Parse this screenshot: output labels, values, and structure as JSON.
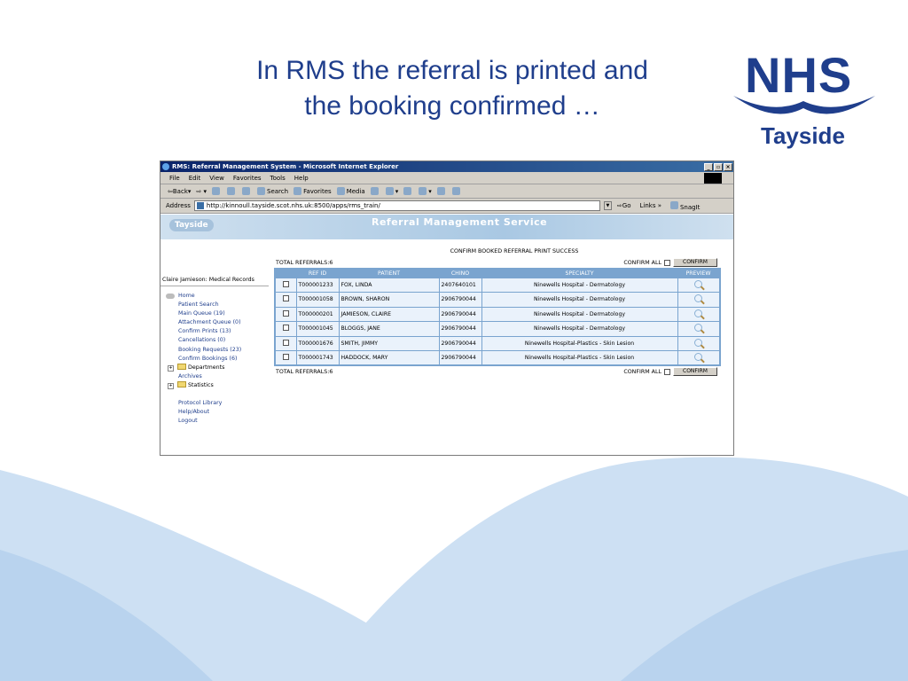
{
  "slide": {
    "title_line1": "In RMS the referral is printed and",
    "title_line2": "the booking confirmed …",
    "logo_text": "NHS",
    "logo_subtext": "Tayside",
    "brand_color": "#1f3e8c",
    "wave_color": "#cde0f3"
  },
  "browser": {
    "window_title": "RMS: Referral Management System - Microsoft Internet Explorer",
    "menu": [
      "File",
      "Edit",
      "View",
      "Favorites",
      "Tools",
      "Help"
    ],
    "toolbar": [
      "Back",
      "Search",
      "Favorites",
      "Media"
    ],
    "address_label": "Address",
    "address_url": "http://kinnoull.tayside.scot.nhs.uk:8500/apps/rms_train/",
    "go_label": "Go",
    "links_label": "Links",
    "snagit_label": "SnagIt"
  },
  "app": {
    "banner_logo": "Tayside",
    "banner_title": "Referral Management Service",
    "user": "Claire Jamieson: Medical Records",
    "nav": {
      "home": "Home",
      "patient_search": "Patient Search",
      "main_queue": "Main Queue (19)",
      "attachment_queue": "Attachment Queue (0)",
      "confirm_prints": "Confirm Prints (13)",
      "cancellations": "Cancellations (0)",
      "booking_requests": "Booking Requests (23)",
      "confirm_bookings": "Confirm Bookings (6)",
      "departments": "Departments",
      "archives": "Archives",
      "statistics": "Statistics",
      "protocol_library": "Protocol Library",
      "help_about": "Help/About",
      "logout": "Logout"
    },
    "confirm_message": "CONFIRM BOOKED REFERRAL PRINT SUCCESS",
    "total_referrals": "TOTAL REFERRALS:6",
    "confirm_all_label": "CONFIRM ALL",
    "confirm_button": "CONFIRM",
    "columns": {
      "ref_id": "REF ID",
      "patient": "PATIENT",
      "chino": "CHINO",
      "specialty": "SPECIALTY",
      "preview": "PREVIEW"
    },
    "rows": [
      {
        "ref_id": "T000001233",
        "patient": "FOX, LINDA",
        "chino": "2407640101",
        "specialty": "Ninewells Hospital - Dermatology"
      },
      {
        "ref_id": "T000001058",
        "patient": "BROWN, SHARON",
        "chino": "2906790044",
        "specialty": "Ninewells Hospital - Dermatology"
      },
      {
        "ref_id": "T000000201",
        "patient": "JAMIESON, CLAIRE",
        "chino": "2906790044",
        "specialty": "Ninewells Hospital - Dermatology"
      },
      {
        "ref_id": "T000001045",
        "patient": "BLOGGS, JANE",
        "chino": "2906790044",
        "specialty": "Ninewells Hospital - Dermatology"
      },
      {
        "ref_id": "T000001676",
        "patient": "SMITH, JIMMY",
        "chino": "2906790044",
        "specialty": "Ninewells Hospital-Plastics - Skin Lesion"
      },
      {
        "ref_id": "T000001743",
        "patient": "HADDOCK, MARY",
        "chino": "2906790044",
        "specialty": "Ninewells Hospital-Plastics - Skin Lesion"
      }
    ]
  }
}
